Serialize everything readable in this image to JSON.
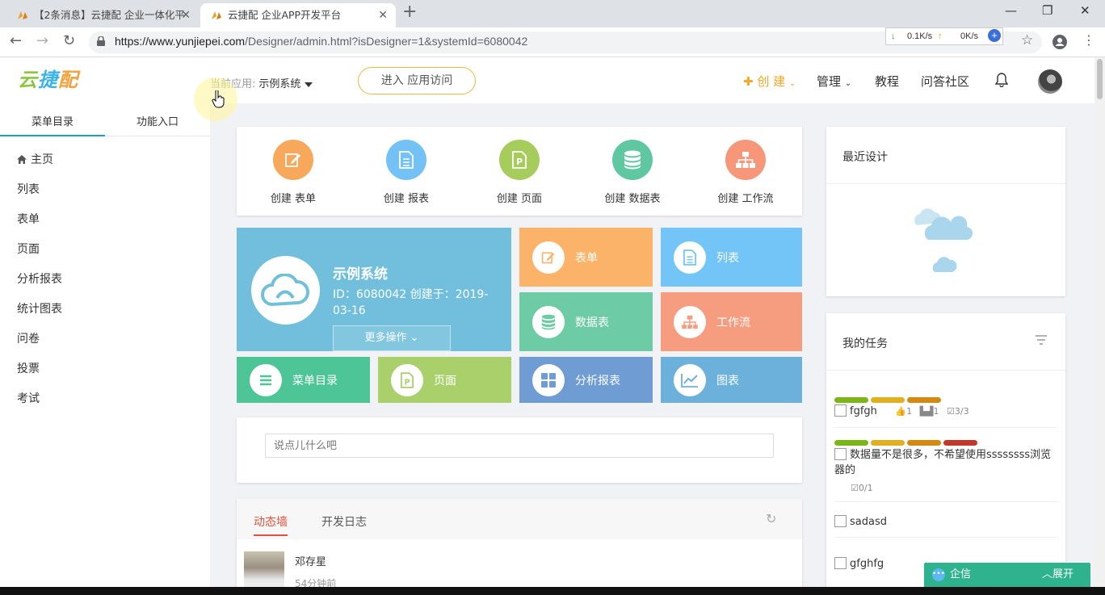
{
  "browser": {
    "tabs": [
      {
        "title": "【2条消息】云捷配 企业一体化平",
        "active": false
      },
      {
        "title": "云捷配 企业APP开发平台",
        "active": true
      }
    ],
    "new_tab": "+",
    "url_host": "https://www.yunjiepei.com",
    "url_path": "/Designer/admin.html?isDesigner=1&systemId=6080042",
    "net_down": "0.1K/s",
    "net_up": "0K/s",
    "window_controls": [
      "minimize",
      "restore",
      "close"
    ]
  },
  "header": {
    "logo_parts": [
      "云",
      "捷",
      "配"
    ],
    "current_app_label": "当前应用:",
    "current_app_value": "示例系统",
    "enter_button": "进入 应用访问",
    "nav": {
      "create": "✚ 创 建",
      "manage": "管理",
      "tutorial": "教程",
      "community": "问答社区"
    }
  },
  "sidebar": {
    "tabs": [
      "菜单目录",
      "功能入口"
    ],
    "items": [
      "主页",
      "列表",
      "表单",
      "页面",
      "分析报表",
      "统计图表",
      "问卷",
      "投票",
      "考试"
    ]
  },
  "quick_create": [
    {
      "label": "创建  表单",
      "color": "#f8a85b",
      "icon": "edit-icon"
    },
    {
      "label": "创建  报表",
      "color": "#73c1f5",
      "icon": "document-icon"
    },
    {
      "label": "创建  页面",
      "color": "#a6cc5c",
      "icon": "page-p-icon"
    },
    {
      "label": "创建  数据表",
      "color": "#5fc7a2",
      "icon": "database-icon"
    },
    {
      "label": "创建  工作流",
      "color": "#f7977a",
      "icon": "workflow-icon"
    }
  ],
  "app_card": {
    "name": "示例系统",
    "meta": "ID：6080042   创建于：2019-03-16",
    "more_button": "更多操作 ⌄",
    "color": "#71bfdc"
  },
  "tiles": [
    {
      "label": "表单",
      "color": "#fab368",
      "icon": "edit-icon"
    },
    {
      "label": "列表",
      "color": "#72c5f6",
      "icon": "document-icon"
    },
    {
      "label": "数据表",
      "color": "#6dcba5",
      "icon": "database-icon"
    },
    {
      "label": "工作流",
      "color": "#f69d80",
      "icon": "workflow-icon"
    },
    {
      "label": "菜单目录",
      "color": "#4dc596",
      "icon": "menu-icon"
    },
    {
      "label": "页面",
      "color": "#a9d06a",
      "icon": "page-p-icon"
    },
    {
      "label": "分析报表",
      "color": "#6f9dd3",
      "icon": "grid-icon"
    },
    {
      "label": "图表",
      "color": "#6cb1db",
      "icon": "line-chart-icon"
    }
  ],
  "post_box": {
    "placeholder": "说点儿什么吧"
  },
  "feed": {
    "tabs": [
      "动态墙",
      "开发日志"
    ],
    "entries": [
      {
        "author": "邓存星",
        "time": "54分钟前"
      }
    ]
  },
  "recent_design": {
    "title": "最近设计"
  },
  "my_tasks": {
    "title": "我的任务",
    "items": [
      {
        "name": "fgfgh",
        "likes": "1",
        "people": "1",
        "progress": "3/3",
        "bars": [
          "#7cb518",
          "#e0b020",
          "#d48a10"
        ]
      },
      {
        "name": "数据量不是很多，不希望使用ssssssss浏览器的",
        "progress": "0/1",
        "bars": [
          "#7cb518",
          "#e0b020",
          "#d48a10",
          "#c0392b"
        ]
      },
      {
        "name": "sadasd"
      },
      {
        "name": "gfghfg"
      }
    ]
  },
  "qixin": {
    "label": "企信",
    "expand": "展开"
  }
}
